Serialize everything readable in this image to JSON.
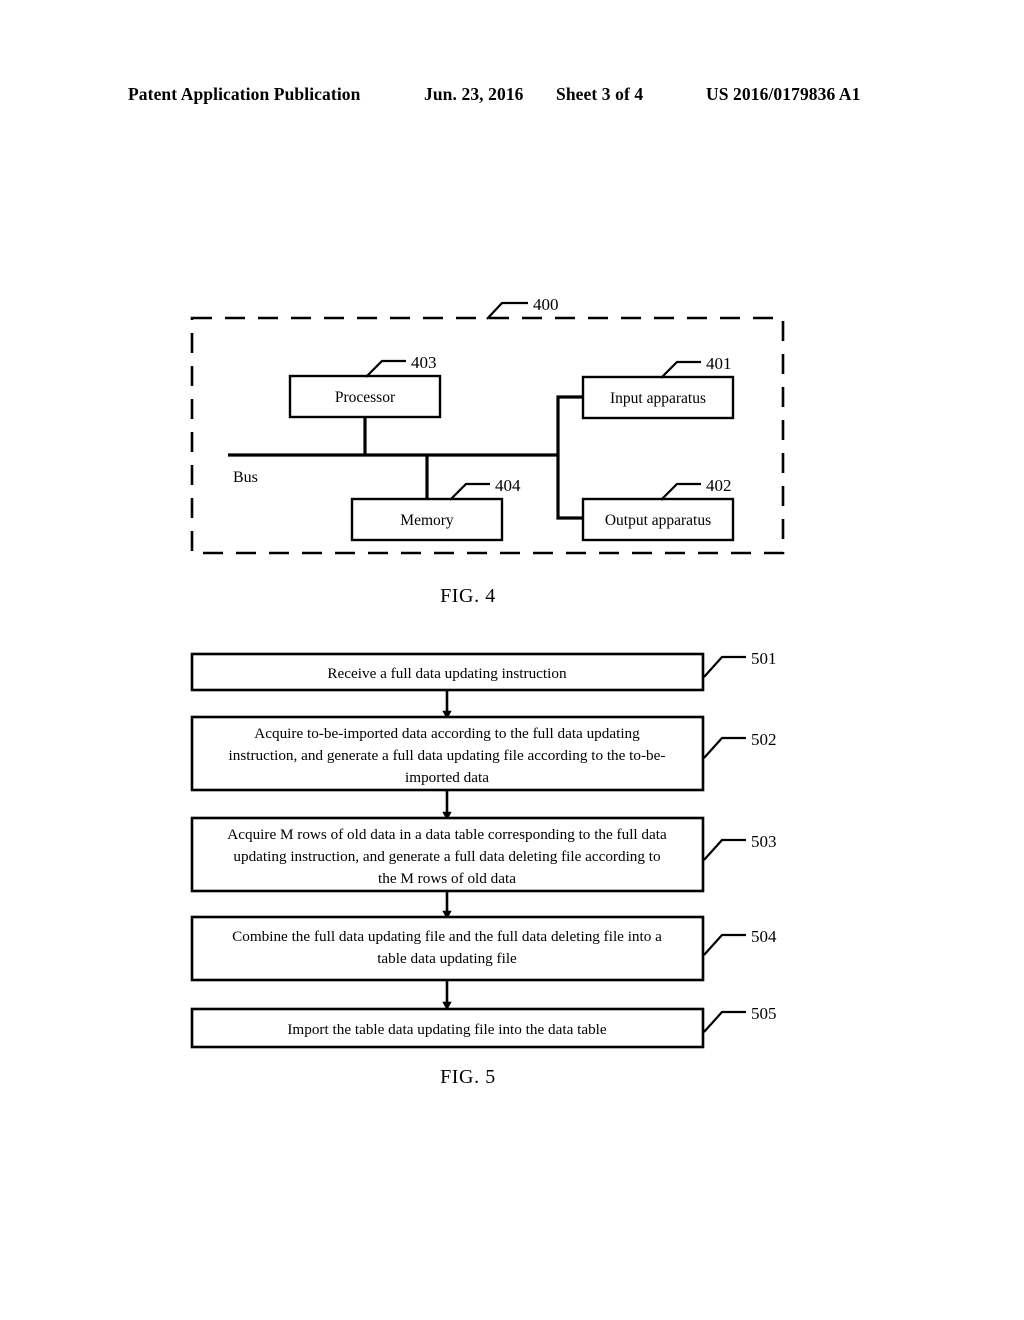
{
  "header": {
    "publication": "Patent Application Publication",
    "date": "Jun. 23, 2016",
    "sheet": "Sheet 3 of 4",
    "doc_number": "US 2016/0179836 A1"
  },
  "figures": [
    {
      "caption": "FIG. 4",
      "ref": "400",
      "bus_label": "Bus",
      "blocks": [
        {
          "id": "processor",
          "label": "Processor",
          "ref": "403"
        },
        {
          "id": "input-apparatus",
          "label": "Input apparatus",
          "ref": "401"
        },
        {
          "id": "memory",
          "label": "Memory",
          "ref": "404"
        },
        {
          "id": "output-apparatus",
          "label": "Output apparatus",
          "ref": "402"
        }
      ]
    },
    {
      "caption": "FIG. 5",
      "steps": [
        {
          "ref": "501",
          "lines": [
            "Receive a full data updating instruction"
          ]
        },
        {
          "ref": "502",
          "lines": [
            "Acquire to-be-imported data according to the full data updating",
            "instruction, and generate a full data updating file according to the to-be-",
            "imported data"
          ]
        },
        {
          "ref": "503",
          "lines": [
            "Acquire M rows of old data in a data table corresponding to the full data",
            "updating instruction, and generate a full data deleting file according to",
            "the M rows of old data"
          ]
        },
        {
          "ref": "504",
          "lines": [
            "Combine the full data updating file and the full data deleting file into a",
            "table data updating file"
          ]
        },
        {
          "ref": "505",
          "lines": [
            "Import the table data updating file into the data table"
          ]
        }
      ]
    }
  ],
  "colors": {
    "ink": "#000000",
    "paper": "#ffffff"
  }
}
